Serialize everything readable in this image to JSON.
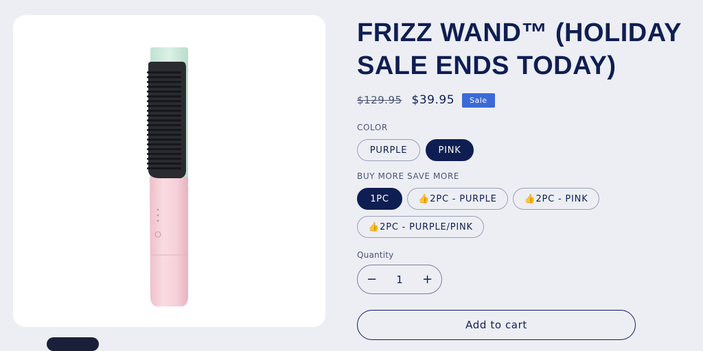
{
  "product": {
    "title": "FRIZZ WAND™ (HOLIDAY SALE ENDS TODAY)",
    "price_original": "$129.95",
    "price_sale": "$39.95",
    "sale_badge": "Sale",
    "image_icon": "hair-straightener-brush-image"
  },
  "color_option": {
    "label": "COLOR",
    "values": [
      "PURPLE",
      "PINK"
    ],
    "selected": "PINK"
  },
  "bundle_option": {
    "label": "BUY MORE SAVE MORE",
    "values": [
      "1PC",
      "👍2PC - PURPLE",
      "👍2PC - PINK",
      "👍2PC - PURPLE/PINK"
    ],
    "selected": "1PC"
  },
  "quantity": {
    "label": "Quantity",
    "value": "1",
    "decrease_symbol": "−",
    "increase_symbol": "+"
  },
  "cart": {
    "add_label": "Add to cart"
  },
  "colors": {
    "background": "#eceef4",
    "primary": "#0f1e52",
    "sale_badge": "#3b6ad6",
    "product_pink": "#f5cdd6",
    "product_mint": "#cfe9de"
  }
}
